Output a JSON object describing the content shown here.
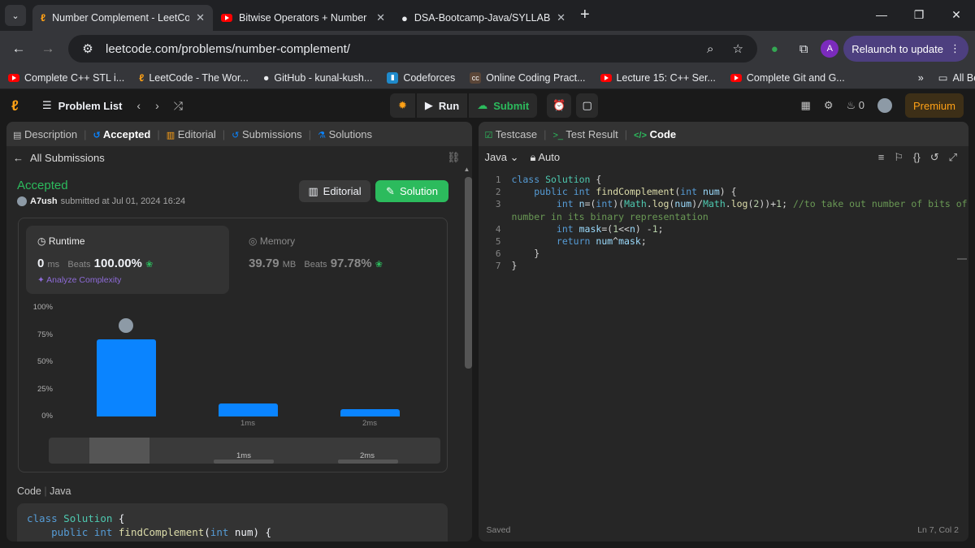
{
  "browser": {
    "tabs": [
      {
        "title": "Number Complement - LeetCo",
        "icon": "leetcode-icon",
        "active": true
      },
      {
        "title": "Bitwise Operators + Number Sy",
        "icon": "youtube-icon",
        "active": false
      },
      {
        "title": "DSA-Bootcamp-Java/SYLLABUS",
        "icon": "github-icon",
        "active": false
      }
    ],
    "url": "leetcode.com/problems/number-complement/",
    "profile_initial": "A",
    "relaunch_label": "Relaunch to update",
    "bookmarks": [
      {
        "label": "Complete C++ STL i...",
        "icon": "youtube-icon"
      },
      {
        "label": "LeetCode - The Wor...",
        "icon": "leetcode-icon"
      },
      {
        "label": "GitHub - kunal-kush...",
        "icon": "github-icon"
      },
      {
        "label": "Codeforces",
        "icon": "codeforces-icon"
      },
      {
        "label": "Online Coding Pract...",
        "icon": "codechef-icon"
      },
      {
        "label": "Lecture 15: C++ Ser...",
        "icon": "youtube-icon"
      },
      {
        "label": "Complete Git and G...",
        "icon": "youtube-icon"
      }
    ],
    "all_bookmarks": "All Bookmarks"
  },
  "lc": {
    "problem_list": "Problem List",
    "run": "Run",
    "submit": "Submit",
    "streak": "0",
    "premium": "Premium"
  },
  "left": {
    "tabs": [
      "Description",
      "Accepted",
      "Editorial",
      "Submissions",
      "Solutions"
    ],
    "back_label": "All Submissions",
    "status": "Accepted",
    "user": "A7ush",
    "submitted": "submitted at Jul 01, 2024 16:24",
    "editorial_btn": "Editorial",
    "solution_btn": "Solution",
    "runtime_label": "Runtime",
    "runtime_value": "0",
    "runtime_unit": "ms",
    "beats_label": "Beats",
    "runtime_beats": "100.00%",
    "analyze": "Analyze Complexity",
    "memory_label": "Memory",
    "memory_value": "39.79",
    "memory_unit": "MB",
    "memory_beats": "97.78%",
    "code_label": "Code",
    "code_lang": "Java",
    "code_lines": [
      "class Solution {",
      "    public int findComplement(int num) {"
    ]
  },
  "chart_data": {
    "type": "bar",
    "categories": [
      "",
      "1ms",
      "2ms"
    ],
    "values": [
      71,
      12,
      7
    ],
    "yticks": [
      "100%",
      "75%",
      "50%",
      "25%",
      "0%"
    ],
    "ylim": [
      0,
      100
    ],
    "slider_labels": [
      "1ms",
      "2ms"
    ]
  },
  "right": {
    "tabs": [
      "Testcase",
      "Test Result",
      "Code"
    ],
    "lang": "Java",
    "mode": "Auto",
    "saved": "Saved",
    "cursor": "Ln 7, Col 2",
    "line_numbers": [
      "1",
      "2",
      "3",
      "",
      "4",
      "5",
      "6",
      "7"
    ]
  }
}
